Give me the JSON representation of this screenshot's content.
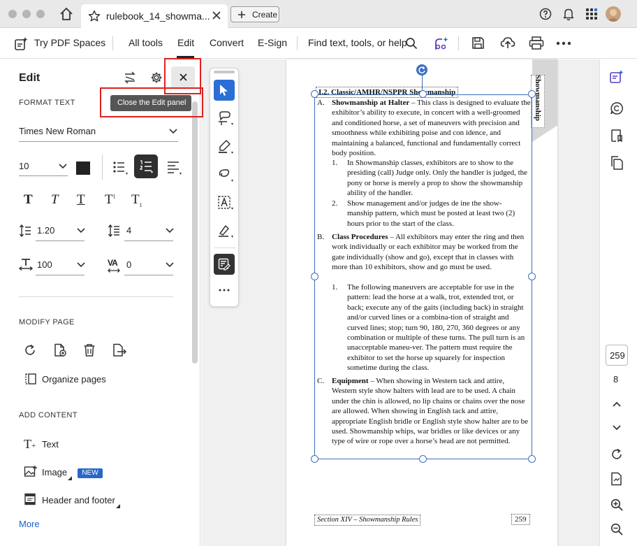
{
  "browser": {
    "tab_title": "rulebook_14_showma...",
    "create_label": "Create"
  },
  "toolbar": {
    "try_pdf_spaces": "Try PDF Spaces",
    "all_tools": "All tools",
    "edit": "Edit",
    "convert": "Convert",
    "esign": "E-Sign",
    "find": "Find text, tools, or help"
  },
  "edit_panel": {
    "title": "Edit",
    "close_tooltip": "Close the Edit panel",
    "format_text_heading": "FORMAT TEXT",
    "font_family": "Times New Roman",
    "font_size": "10",
    "line_spacing": "1.20",
    "paragraph_spacing": "4",
    "horizontal_scale": "100",
    "char_spacing": "0",
    "modify_page_heading": "MODIFY PAGE",
    "organize_pages": "Organize pages",
    "add_content_heading": "ADD CONTENT",
    "text_label": "Text",
    "image_label": "Image",
    "new_badge": "NEW",
    "header_footer_label": "Header and footer",
    "more_link": "More"
  },
  "document": {
    "side_tab": "Showmanship",
    "heading": "I.2. Classic/AMHR/NSPPR Showmanship",
    "item_a_letter": "A.",
    "item_a_title": "Showmanship at Halter",
    "item_a_text": " – This class is designed to evaluate the exhibitor’s ability to execute, in concert with a well-groomed and conditioned horse, a set of maneuvers with precision and smoothness while exhibiting poise and con idence, and maintaining a balanced, functional and fundamentally correct body position.",
    "item_a1_num": "1.",
    "item_a1_text": "In Showmanship classes, exhibitors are to show to the presiding (call) Judge only. Only the handler is judged, the pony or horse is merely a prop to show the showmanship ability of the handler.",
    "item_a2_num": "2.",
    "item_a2_text": "Show management and/or judges de ine the show-manship pattern, which must be posted at least two (2) hours prior to the start of the class.",
    "item_b_letter": "B.",
    "item_b_title": "Class Procedures",
    "item_b_text": " – All exhibitors may enter the ring and then work individually or each exhibitor may be worked from the gate individually (show and go), except that in classes with more than 10 exhibitors, show and go must be used.",
    "item_b1_num": "1.",
    "item_b1_text": "The following maneuvers are acceptable for use in the pattern: lead the horse at a walk, trot, extended trot, or back; execute any of the gaits (including back) in straight and/or curved lines or a combina-tion of straight and curved lines; stop; turn 90, 180, 270, 360 degrees or any combination or multiple of these turns. The pull turn is an unacceptable maneu-ver. The pattern must require the exhibitor to set the horse up squarely for inspection sometime during the class.",
    "item_c_letter": "C.",
    "item_c_title": "Equipment",
    "item_c_text": " – When showing in Western tack and attire, Western style show halters with lead are to be used. A chain under the chin is allowed, no lip chains or chains over the nose are allowed. When showing in English tack and attire, appropriate English bridle or English style show halter are to be used. Showmanship whips, war bridles or like devices or any type of wire or rope over a horse’s head are not permitted.",
    "footer_section": "Section XIV – Showmanship Rules",
    "footer_page": "259"
  },
  "right_rail": {
    "current_page": "259",
    "total_pages": "8"
  },
  "colors": {
    "accent_blue": "#1a5fd0",
    "selection_blue": "#3d6fc0",
    "highlight_red": "#e02020",
    "new_badge_bg": "#2868c8"
  }
}
